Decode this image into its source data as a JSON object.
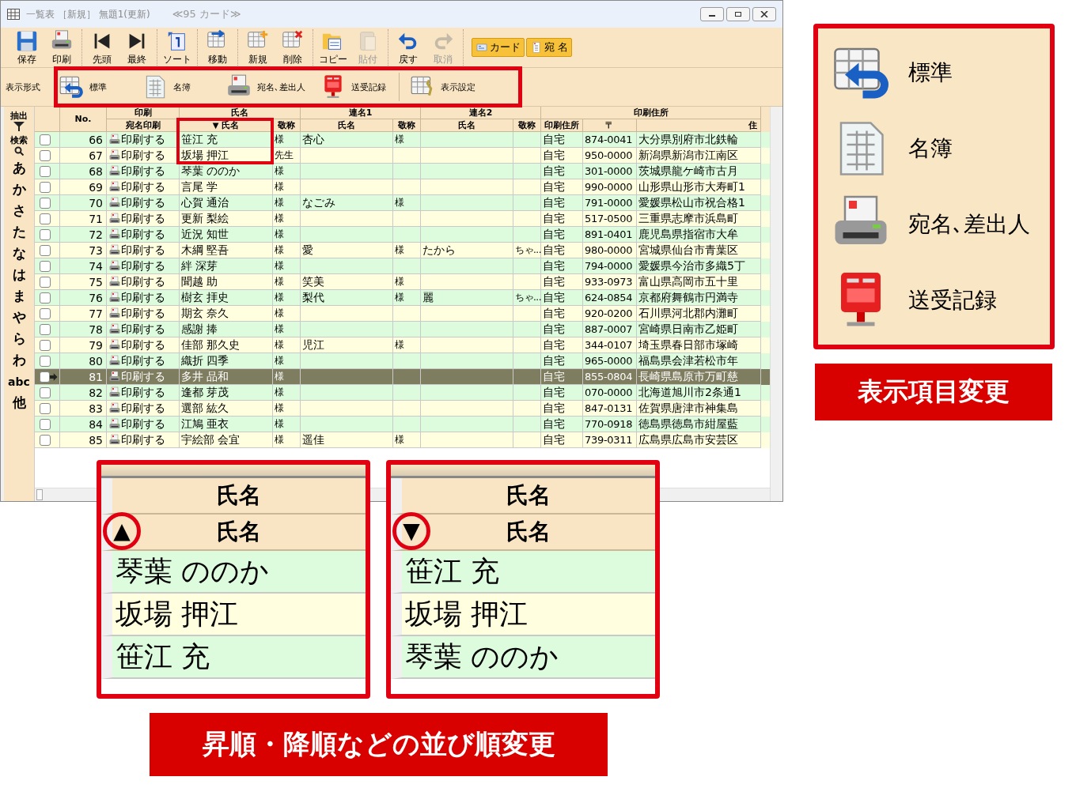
{
  "window": {
    "title": "一覧表 ［新規］ 無題1(更新)",
    "card_count": "≪95 カード≫"
  },
  "toolbar": {
    "groups": [
      {
        "items": [
          {
            "label": "保存",
            "kind": "save",
            "disabled": false
          },
          {
            "label": "印刷",
            "kind": "print",
            "disabled": false
          }
        ]
      },
      {
        "items": [
          {
            "label": "先頭",
            "kind": "first",
            "disabled": false
          },
          {
            "label": "最終",
            "kind": "last",
            "disabled": false
          }
        ]
      },
      {
        "items": [
          {
            "label": "ソート",
            "kind": "sort",
            "disabled": false
          }
        ]
      },
      {
        "items": [
          {
            "label": "移動",
            "kind": "move",
            "disabled": false
          }
        ]
      },
      {
        "items": [
          {
            "label": "新規",
            "kind": "new",
            "disabled": false
          },
          {
            "label": "削除",
            "kind": "delete",
            "disabled": false
          }
        ]
      },
      {
        "items": [
          {
            "label": "コピー",
            "kind": "copy",
            "disabled": false
          },
          {
            "label": "貼付",
            "kind": "paste",
            "disabled": true
          }
        ]
      },
      {
        "items": [
          {
            "label": "戻す",
            "kind": "undo",
            "disabled": false
          },
          {
            "label": "取消",
            "kind": "redo",
            "disabled": true
          }
        ]
      }
    ],
    "modes": [
      {
        "label": "カード",
        "kind": "card"
      },
      {
        "label": "宛 名",
        "kind": "address"
      }
    ]
  },
  "view_bar": {
    "label": "表示形式",
    "items": [
      {
        "label": "標準",
        "kind": "standard"
      },
      {
        "label": "名簿",
        "kind": "list"
      },
      {
        "label": "宛名､差出人",
        "kind": "sender"
      },
      {
        "label": "送受記録",
        "kind": "log"
      },
      {
        "label": "表示設定",
        "kind": "settings"
      }
    ]
  },
  "sidebar": {
    "filter": "抽出",
    "search": "検索",
    "index": [
      "あ",
      "か",
      "さ",
      "た",
      "な",
      "は",
      "ま",
      "や",
      "ら",
      "わ",
      "abc",
      "他"
    ]
  },
  "table": {
    "number_header": "No.",
    "groups": [
      "印刷",
      "氏名",
      "連名1",
      "連名2",
      "印刷住所"
    ],
    "columns": [
      {
        "label": "宛名印刷"
      },
      {
        "label": "氏名",
        "sort_mark": "▼"
      },
      {
        "label": "敬称"
      },
      {
        "label": "氏名"
      },
      {
        "label": "敬称"
      },
      {
        "label": "氏名"
      },
      {
        "label": "敬称"
      },
      {
        "label": "印刷住所"
      },
      {
        "label": "〒"
      },
      {
        "label": "住"
      }
    ],
    "rows": [
      {
        "no": "66",
        "print": "印刷する",
        "name": "笹江 充",
        "honorific": "様",
        "joint1_name": "杏心",
        "joint1_honorific": "様",
        "address_type": "自宅",
        "postal_code": "874-0041",
        "address": "大分県別府市北鉄輪",
        "checked": false,
        "selected": false
      },
      {
        "no": "67",
        "print": "印刷する",
        "name": "坂場 押江",
        "honorific": "先生",
        "address_type": "自宅",
        "postal_code": "950-0000",
        "address": "新潟県新潟市江南区",
        "checked": false,
        "selected": false
      },
      {
        "no": "68",
        "print": "印刷する",
        "name": "琴葉 ののか",
        "honorific": "様",
        "address_type": "自宅",
        "postal_code": "301-0000",
        "address": "茨城県龍ケ崎市古月",
        "checked": false,
        "selected": false
      },
      {
        "no": "69",
        "print": "印刷する",
        "name": "言尾 学",
        "honorific": "様",
        "address_type": "自宅",
        "postal_code": "990-0000",
        "address": "山形県山形市大寿町1",
        "checked": false,
        "selected": false
      },
      {
        "no": "70",
        "print": "印刷する",
        "name": "心賀 通治",
        "honorific": "様",
        "joint1_name": "なごみ",
        "joint1_honorific": "様",
        "address_type": "自宅",
        "postal_code": "791-0000",
        "address": "愛媛県松山市祝合格1",
        "checked": false,
        "selected": false
      },
      {
        "no": "71",
        "print": "印刷する",
        "name": "更新 梨絵",
        "honorific": "様",
        "address_type": "自宅",
        "postal_code": "517-0500",
        "address": "三重県志摩市浜島町",
        "checked": false,
        "selected": false
      },
      {
        "no": "72",
        "print": "印刷する",
        "name": "近況 知世",
        "honorific": "様",
        "address_type": "自宅",
        "postal_code": "891-0401",
        "address": "鹿児島県指宿市大牟",
        "checked": false,
        "selected": false
      },
      {
        "no": "73",
        "print": "印刷する",
        "name": "木綱 堅吾",
        "honorific": "様",
        "joint1_name": "愛",
        "joint1_honorific": "様",
        "joint2_name": "たから",
        "joint2_honorific": "ちゃ...",
        "address_type": "自宅",
        "postal_code": "980-0000",
        "address": "宮城県仙台市青葉区",
        "checked": false,
        "selected": false
      },
      {
        "no": "74",
        "print": "印刷する",
        "name": "絆 深芽",
        "honorific": "様",
        "address_type": "自宅",
        "postal_code": "794-0000",
        "address": "愛媛県今治市多織5丁",
        "checked": false,
        "selected": false
      },
      {
        "no": "75",
        "print": "印刷する",
        "name": "聞越 助",
        "honorific": "様",
        "joint1_name": "笑美",
        "joint1_honorific": "様",
        "address_type": "自宅",
        "postal_code": "933-0973",
        "address": "富山県高岡市五十里",
        "checked": false,
        "selected": false
      },
      {
        "no": "76",
        "print": "印刷する",
        "name": "樹玄 拝史",
        "honorific": "様",
        "joint1_name": "梨代",
        "joint1_honorific": "様",
        "joint2_name": "麗",
        "joint2_honorific": "ちゃ...",
        "address_type": "自宅",
        "postal_code": "624-0854",
        "address": "京都府舞鶴市円満寺",
        "checked": false,
        "selected": false
      },
      {
        "no": "77",
        "print": "印刷する",
        "name": "期玄 奈久",
        "honorific": "様",
        "address_type": "自宅",
        "postal_code": "920-0200",
        "address": "石川県河北郡内灘町",
        "checked": false,
        "selected": false
      },
      {
        "no": "78",
        "print": "印刷する",
        "name": "感謝 捧",
        "honorific": "様",
        "address_type": "自宅",
        "postal_code": "887-0007",
        "address": "宮崎県日南市乙姫町",
        "checked": false,
        "selected": false
      },
      {
        "no": "79",
        "print": "印刷する",
        "name": "佳部 那久史",
        "honorific": "様",
        "joint1_name": "児江",
        "joint1_honorific": "様",
        "address_type": "自宅",
        "postal_code": "344-0107",
        "address": "埼玉県春日部市塚崎",
        "checked": false,
        "selected": false
      },
      {
        "no": "80",
        "print": "印刷する",
        "name": "織折 四季",
        "honorific": "様",
        "address_type": "自宅",
        "postal_code": "965-0000",
        "address": "福島県会津若松市年",
        "checked": false,
        "selected": false
      },
      {
        "no": "81",
        "print": "印刷する",
        "name": "多井 品和",
        "honorific": "様",
        "address_type": "自宅",
        "postal_code": "855-0804",
        "address": "長崎県島原市万町慈",
        "checked": false,
        "selected": true
      },
      {
        "no": "82",
        "print": "印刷する",
        "name": "逢都 芽茂",
        "honorific": "様",
        "address_type": "自宅",
        "postal_code": "070-0000",
        "address": "北海道旭川市2条通1",
        "checked": false,
        "selected": false
      },
      {
        "no": "83",
        "print": "印刷する",
        "name": "選部 紘久",
        "honorific": "様",
        "address_type": "自宅",
        "postal_code": "847-0131",
        "address": "佐賀県唐津市神集島",
        "checked": false,
        "selected": false
      },
      {
        "no": "84",
        "print": "印刷する",
        "name": "江鳩 亜衣",
        "honorific": "様",
        "address_type": "自宅",
        "postal_code": "770-0918",
        "address": "徳島県徳島市紺屋藍",
        "checked": false,
        "selected": false
      },
      {
        "no": "85",
        "print": "印刷する",
        "name": "宇絵部 会宜",
        "honorific": "様",
        "joint1_name": "遥佳",
        "joint1_honorific": "様",
        "address_type": "自宅",
        "postal_code": "739-0311",
        "address": "広島県広島市安芸区",
        "checked": false,
        "selected": false
      }
    ]
  },
  "view_callout": {
    "items": [
      {
        "label": "標準",
        "kind": "standard"
      },
      {
        "label": "名簿",
        "kind": "list"
      },
      {
        "label": "宛名､差出人",
        "kind": "sender"
      },
      {
        "label": "送受記録",
        "kind": "log"
      }
    ],
    "caption": "表示項目変更"
  },
  "sort_callouts": [
    {
      "group_header": "氏名",
      "header": "氏名",
      "sort_mark": "▲",
      "rows": [
        "琴葉 ののか",
        "坂場 押江",
        "笹江 充"
      ]
    },
    {
      "group_header": "氏名",
      "header": "氏名",
      "sort_mark": "▼",
      "rows": [
        "笹江 充",
        "坂場 押江",
        "琴葉 ののか"
      ]
    }
  ],
  "sort_caption": "昇順・降順などの並び順変更"
}
